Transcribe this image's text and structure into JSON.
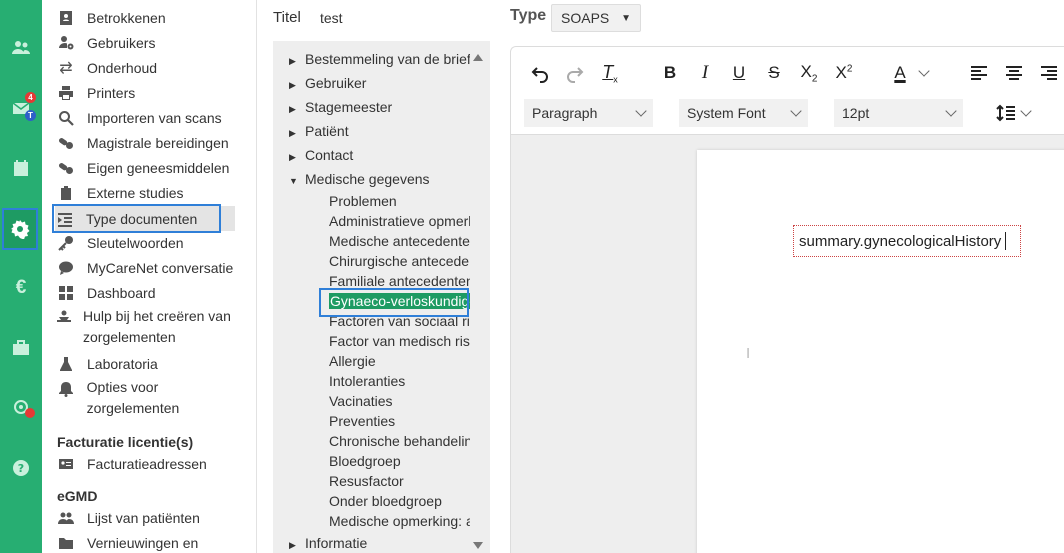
{
  "rail": {
    "items": [
      {
        "icon": "users-icon"
      },
      {
        "icon": "mail-icon",
        "badge_count": "4",
        "badge_letter": "T"
      },
      {
        "icon": "calendar-icon"
      },
      {
        "icon": "gear-icon"
      },
      {
        "icon": "euro-icon"
      },
      {
        "icon": "briefcase-icon"
      },
      {
        "icon": "location-icon"
      },
      {
        "icon": "help-icon"
      }
    ]
  },
  "menu": {
    "items": [
      {
        "label": "Betrokkenen",
        "icon": "contact-card-icon"
      },
      {
        "label": "Gebruikers",
        "icon": "user-gear-icon"
      },
      {
        "label": "Onderhoud",
        "icon": "swap-arrows-icon"
      },
      {
        "label": "Printers",
        "icon": "printer-icon"
      },
      {
        "label": "Importeren van scans",
        "icon": "search-icon"
      },
      {
        "label": "Magistrale bereidingen",
        "icon": "pills-icon"
      },
      {
        "label": "Eigen geneesmiddelen",
        "icon": "pills-icon"
      },
      {
        "label": "Externe studies",
        "icon": "clipboard-icon"
      },
      {
        "label": "Type documenten",
        "icon": "indent-list-icon"
      },
      {
        "label": "Sleutelwoorden",
        "icon": "key-icon"
      },
      {
        "label": "MyCareNet conversatie",
        "icon": "chat-icon"
      },
      {
        "label": "Dashboard",
        "icon": "dashboard-icon"
      },
      {
        "label": "Hulp bij het creëren van zorgelementen",
        "icon": "hands-icon"
      },
      {
        "label": "Laboratoria",
        "icon": "flask-icon"
      },
      {
        "label": "Opties voor zorgelementen",
        "icon": "bell-icon"
      }
    ],
    "section_billing": "Facturatie licentie(s)",
    "billing_items": [
      {
        "label": "Facturatieadressen",
        "icon": "address-card-icon"
      }
    ],
    "section_egmd": "eGMD",
    "egmd_items": [
      {
        "label": "Lijst van patiënten",
        "icon": "users-icon"
      },
      {
        "label": "Vernieuwingen en",
        "icon": "folder-icon"
      }
    ]
  },
  "form": {
    "title_label": "Titel",
    "title_value": "test",
    "type_label": "Type",
    "type_value": "SOAPS"
  },
  "tree": {
    "nodes": [
      {
        "label": "Bestemmeling van de brief",
        "expander": "▶"
      },
      {
        "label": "Gebruiker",
        "expander": "▶"
      },
      {
        "label": "Stagemeester",
        "expander": "▶"
      },
      {
        "label": "Patiënt",
        "expander": "▶"
      },
      {
        "label": "Contact",
        "expander": "▶"
      },
      {
        "label": "Medische gegevens",
        "expander": "▼"
      },
      {
        "label": "Problemen"
      },
      {
        "label": "Administratieve opmerkingen"
      },
      {
        "label": "Medische antecedenten"
      },
      {
        "label": "Chirurgische antecedenten"
      },
      {
        "label": "Familiale antecedenten"
      },
      {
        "label": "Gynaeco-verloskundige"
      },
      {
        "label": "Factoren van sociaal risico"
      },
      {
        "label": "Factor van medisch risico"
      },
      {
        "label": "Allergie"
      },
      {
        "label": "Intoleranties"
      },
      {
        "label": "Vacinaties"
      },
      {
        "label": "Preventies"
      },
      {
        "label": "Chronische behandeling"
      },
      {
        "label": "Bloedgroep"
      },
      {
        "label": "Resusfactor"
      },
      {
        "label": "Onder bloedgroep"
      },
      {
        "label": "Medische opmerking: a"
      },
      {
        "label": "Informatie",
        "expander": "▶"
      }
    ]
  },
  "editor": {
    "block_format": "Paragraph",
    "font_family": "System Font",
    "font_size": "12pt",
    "content": "summary.gynecologicalHistory",
    "text_color_letter": "A",
    "bold_letter": "B",
    "italic_letter": "I",
    "underline_letter": "U",
    "strike_letter": "S"
  }
}
